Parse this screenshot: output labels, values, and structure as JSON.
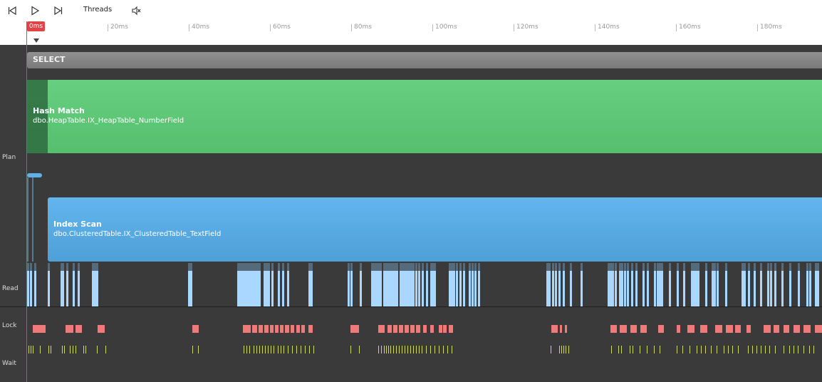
{
  "toolbar": {
    "threads_label": "Threads",
    "icons": [
      "skip-back-icon",
      "play-icon",
      "skip-forward-icon",
      "mute-icon"
    ]
  },
  "ruler": {
    "zero_label": "0ms",
    "ticks": [
      "20ms",
      "40ms",
      "60ms",
      "80ms",
      "100ms",
      "120ms",
      "140ms",
      "160ms",
      "180ms"
    ]
  },
  "rows": {
    "plan_label": "Plan",
    "read_label": "Read",
    "lock_label": "Lock",
    "wait_label": "Wait"
  },
  "operators": {
    "select": {
      "title": "SELECT"
    },
    "hash_match": {
      "title": "Hash Match",
      "object": "dbo.HeapTable.IX_HeapTable_NumberField"
    },
    "index_scan": {
      "title": "Index Scan",
      "object": "dbo.ClusteredTable.IX_ClusteredTable_TextField"
    }
  },
  "colors": {
    "select": "#8a8a8a",
    "hash_match": "#5fcc7a",
    "index_scan": "#5aaee8",
    "read": "#a9d7ff",
    "lock": "#f07a7a",
    "wait": "#cfd66a",
    "cursor": "#e04545",
    "background": "#3a3a3a"
  }
}
